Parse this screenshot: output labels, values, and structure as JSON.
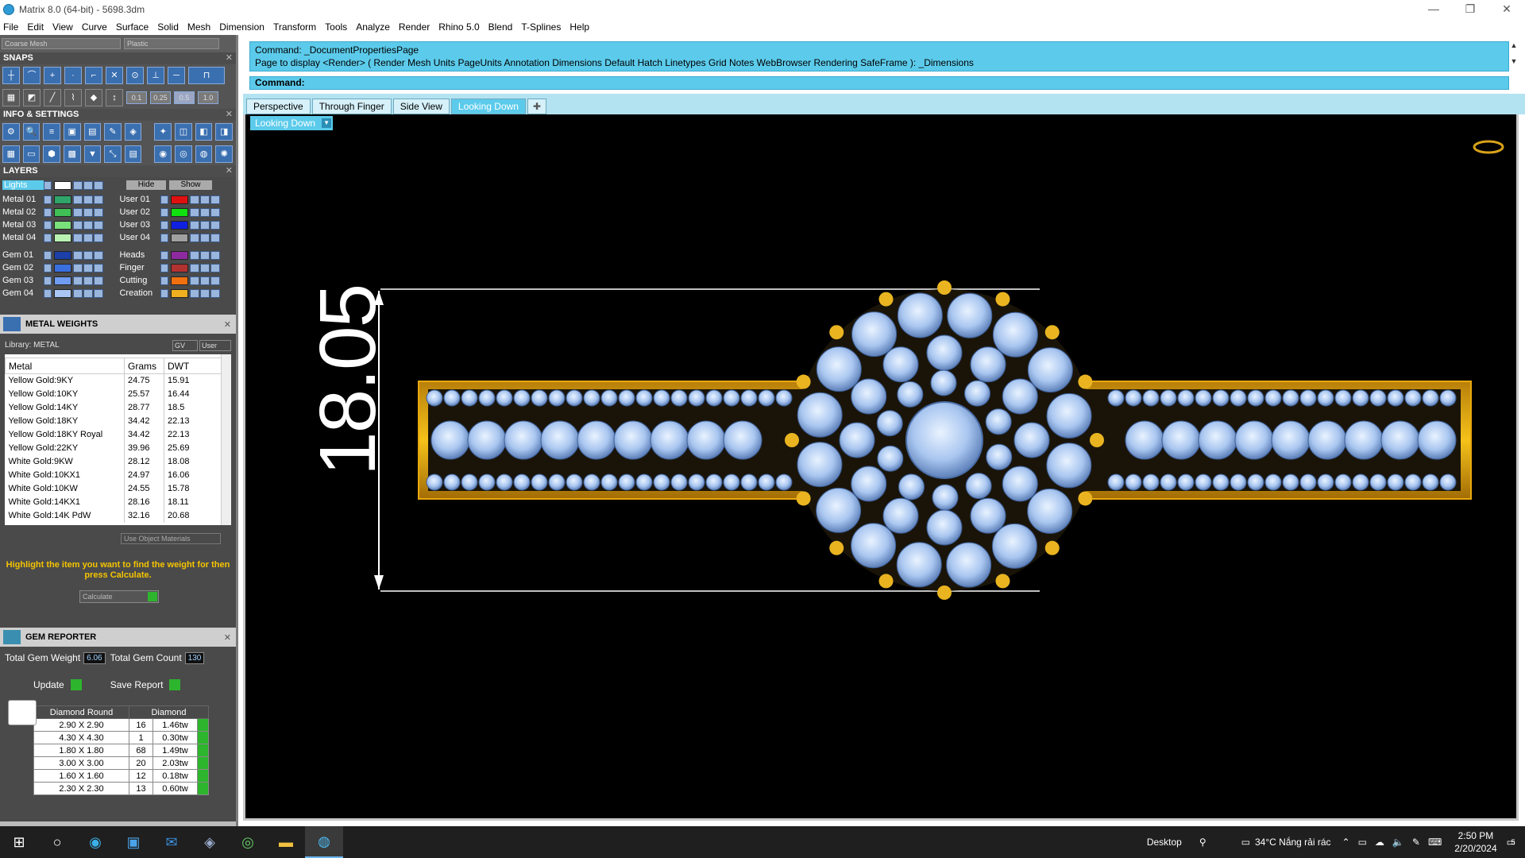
{
  "window": {
    "title": "Matrix 8.0 (64-bit) - 5698.3dm"
  },
  "menu": [
    "File",
    "Edit",
    "View",
    "Curve",
    "Surface",
    "Solid",
    "Mesh",
    "Dimension",
    "Transform",
    "Tools",
    "Analyze",
    "Render",
    "Rhino 5.0",
    "Blend",
    "T-Splines",
    "Help"
  ],
  "topbar": {
    "mesh": "Coarse Mesh",
    "material": "Plastic"
  },
  "snaps": {
    "title": "SNAPS",
    "values": [
      "0.1",
      "0.25",
      "0.5",
      "1.0"
    ]
  },
  "info": {
    "title": "INFO & SETTINGS"
  },
  "layers": {
    "title": "LAYERS",
    "lights": "Lights",
    "hide": "Hide",
    "show": "Show",
    "left": [
      {
        "name": "Metal 01",
        "color": "#2fa56a"
      },
      {
        "name": "Metal 02",
        "color": "#3fbf55"
      },
      {
        "name": "Metal 03",
        "color": "#79e07a"
      },
      {
        "name": "Metal 04",
        "color": "#b9f1b3"
      },
      {
        "name": "Gem 01",
        "color": "#1c3fa8"
      },
      {
        "name": "Gem 02",
        "color": "#3a6fe0"
      },
      {
        "name": "Gem 03",
        "color": "#6f9cf0"
      },
      {
        "name": "Gem 04",
        "color": "#a9c6f5"
      }
    ],
    "right": [
      {
        "name": "User 01",
        "color": "#e01010"
      },
      {
        "name": "User 02",
        "color": "#10e010"
      },
      {
        "name": "User 03",
        "color": "#1020e0"
      },
      {
        "name": "User 04",
        "color": "#a0a0a0"
      },
      {
        "name": "Heads",
        "color": "#8e2aa0"
      },
      {
        "name": "Finger",
        "color": "#b23232"
      },
      {
        "name": "Cutting",
        "color": "#f07010"
      },
      {
        "name": "Creation",
        "color": "#f0b020"
      }
    ]
  },
  "metal_weights": {
    "title": "METAL WEIGHTS",
    "library": "Library: METAL",
    "gv": "GV",
    "user": "User",
    "columns": [
      "Metal",
      "Grams",
      "DWT"
    ],
    "rows": [
      [
        "Yellow Gold:9KY",
        "24.75",
        "15.91"
      ],
      [
        "Yellow Gold:10KY",
        "25.57",
        "16.44"
      ],
      [
        "Yellow Gold:14KY",
        "28.77",
        "18.5"
      ],
      [
        "Yellow Gold:18KY",
        "34.42",
        "22.13"
      ],
      [
        "Yellow Gold:18KY Royal",
        "34.42",
        "22.13"
      ],
      [
        "Yellow Gold:22KY",
        "39.96",
        "25.69"
      ],
      [
        "White Gold:9KW",
        "28.12",
        "18.08"
      ],
      [
        "White Gold:10KX1",
        "24.97",
        "16.06"
      ],
      [
        "White Gold:10KW",
        "24.55",
        "15.78"
      ],
      [
        "White Gold:14KX1",
        "28.16",
        "18.11"
      ],
      [
        "White Gold:14K PdW",
        "32.16",
        "20.68"
      ]
    ],
    "use_object": "Use Object Materials",
    "hint": "Highlight the item you want to find the weight for then press Calculate.",
    "calculate": "Calculate"
  },
  "gem_reporter": {
    "title": "GEM REPORTER",
    "total_weight_label": "Total Gem Weight",
    "total_weight": "6.06",
    "total_count_label": "Total Gem Count",
    "total_count": "130",
    "update": "Update",
    "save": "Save Report",
    "columns": [
      "Diamond Round",
      "Diamond"
    ],
    "rows": [
      [
        "2.90 X 2.90",
        "16",
        "1.46tw"
      ],
      [
        "4.30 X 4.30",
        "1",
        "0.30tw"
      ],
      [
        "1.80 X 1.80",
        "68",
        "1.49tw"
      ],
      [
        "3.00 X 3.00",
        "20",
        "2.03tw"
      ],
      [
        "1.60 X 1.60",
        "12",
        "0.18tw"
      ],
      [
        "2.30 X 2.30",
        "13",
        "0.60tw"
      ]
    ]
  },
  "command": {
    "line1": "Command: _DocumentPropertiesPage",
    "line2": "Page to display <Render> ( Render  Mesh  Units  PageUnits  Annotation  Dimensions  Default  Hatch  Linetypes  Grid  Notes  WebBrowser  Rendering  SafeFrame ): _Dimensions",
    "prompt": "Command:"
  },
  "tabs": [
    "Perspective",
    "Through Finger",
    "Side View",
    "Looking Down"
  ],
  "active_tab": "Looking Down",
  "viewport": {
    "label": "Looking Down",
    "dimension": "18.05"
  },
  "taskbar": {
    "desktop": "Desktop",
    "weather": "34°C  Nắng rải rác",
    "time": "2:50 PM",
    "date": "2/20/2024",
    "notif": "5"
  }
}
